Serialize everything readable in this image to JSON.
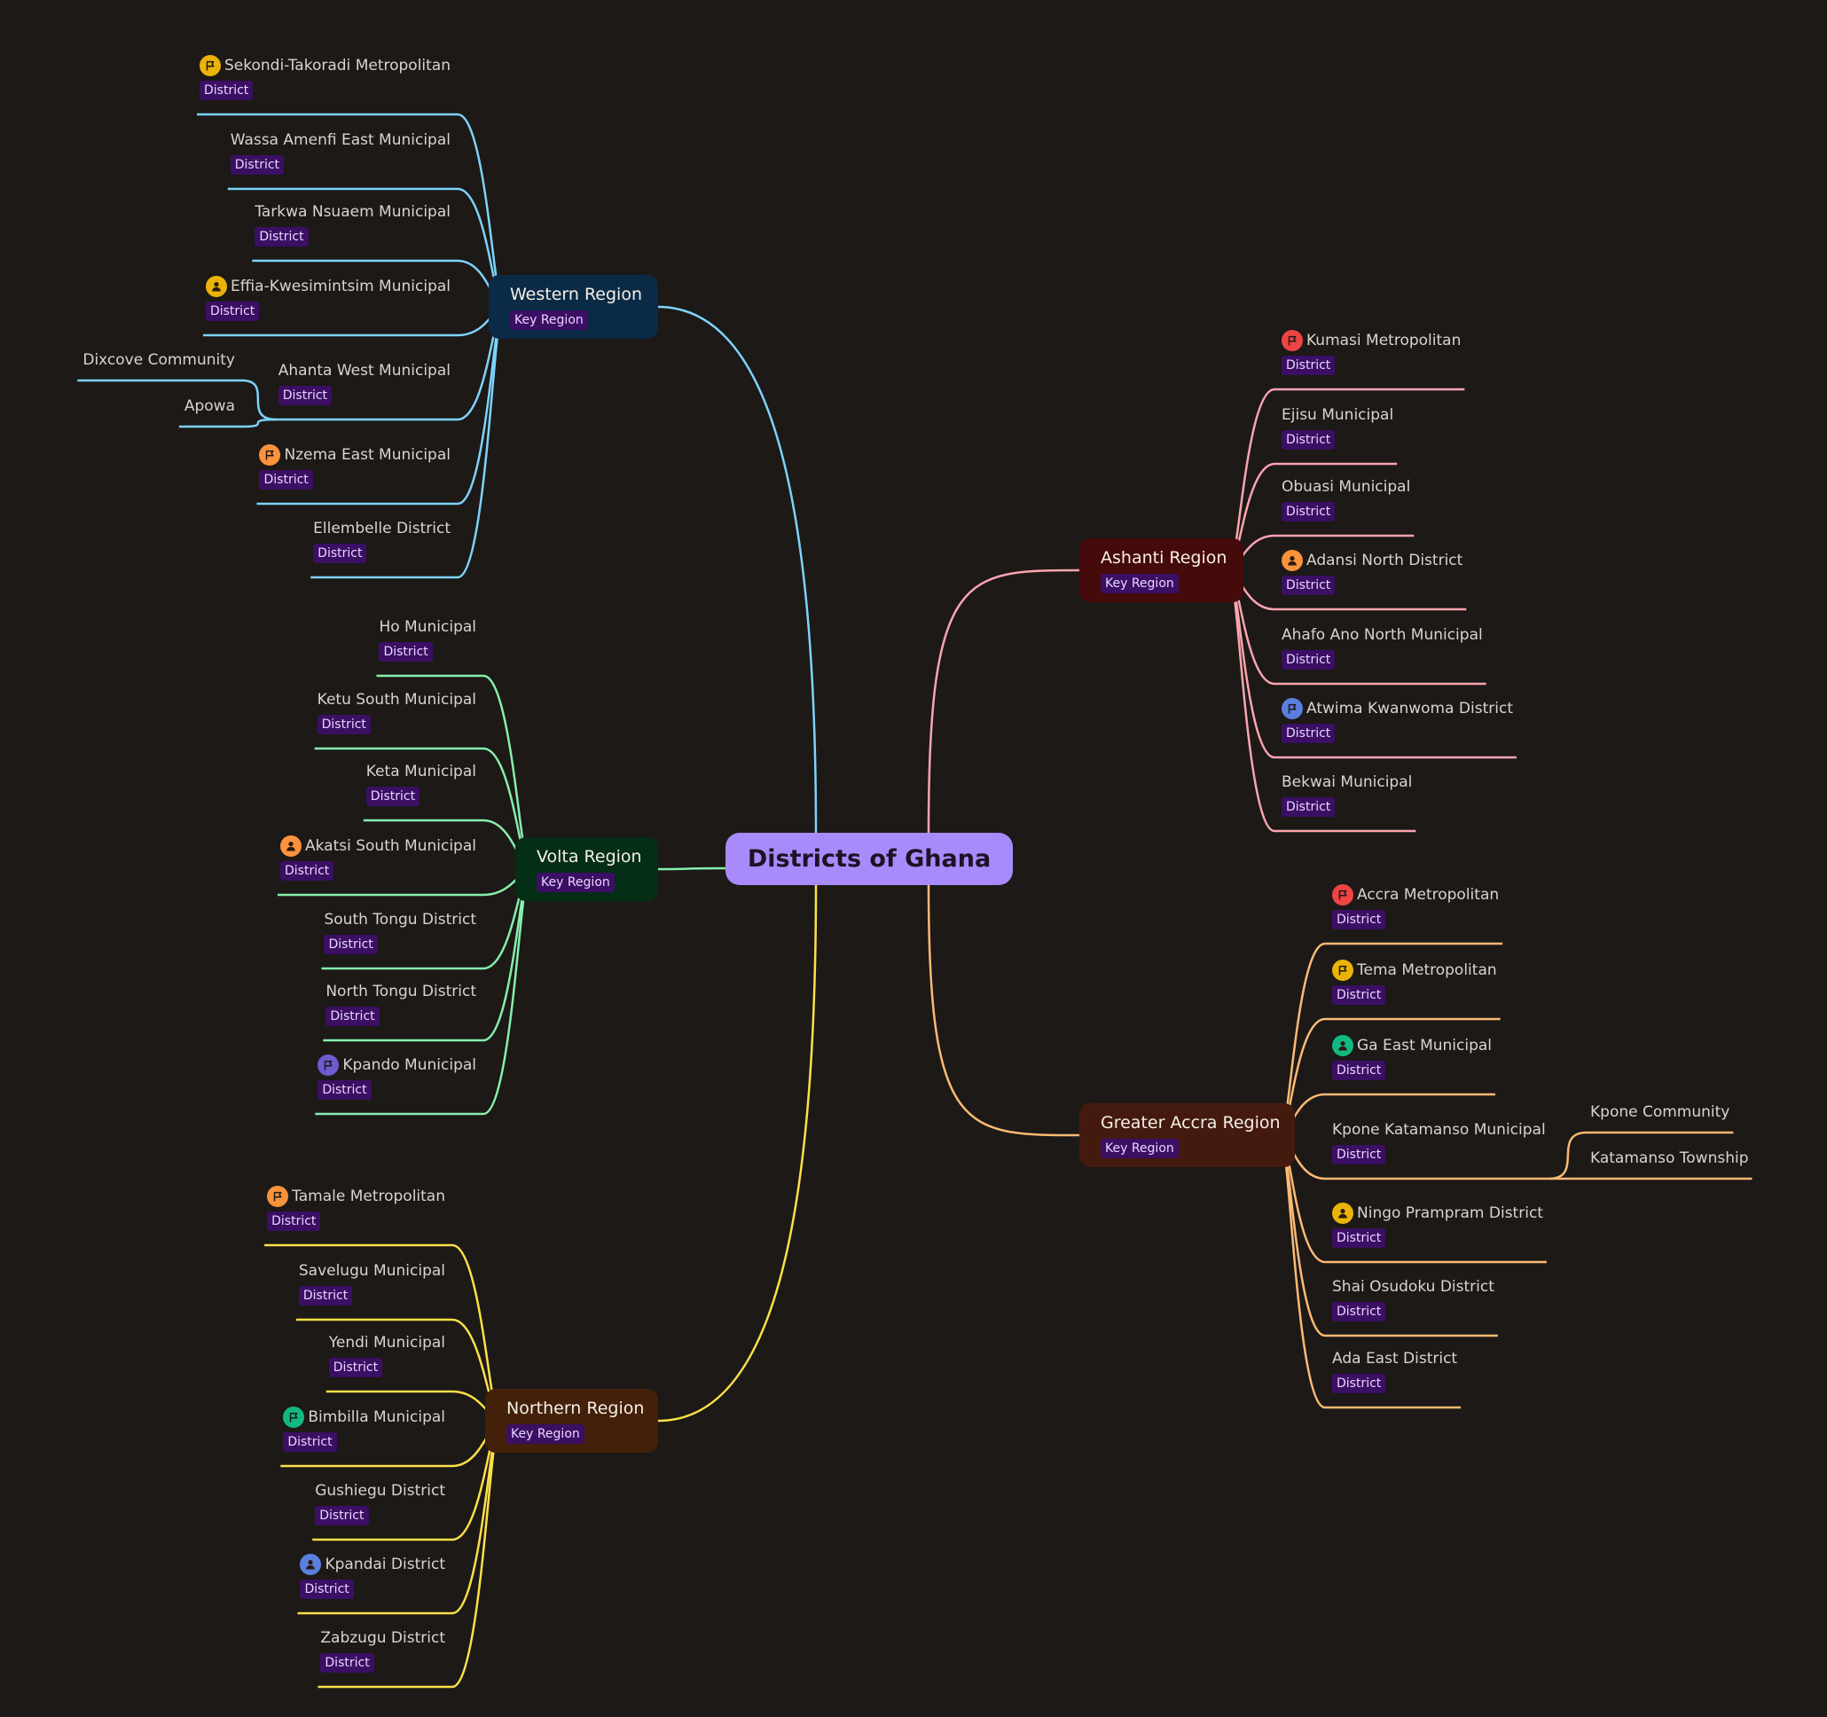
{
  "root": {
    "label": "Districts of Ghana"
  },
  "colors": {
    "background": "#1c1917",
    "root": "#a78bfa",
    "badge": "#3b0f63",
    "western": "#7dd3fc",
    "volta": "#86efac",
    "northern": "#fde047",
    "ashanti": "#fda4af",
    "greater_accra": "#fdba74"
  },
  "regions": [
    {
      "key": "western",
      "label": "Western Region",
      "badge": "Key Region",
      "color": "#7dd3fc",
      "bg": "#0b2a45",
      "districts": [
        {
          "name": "Sekondi-Takoradi Metropolitan",
          "badge": "District",
          "icon": "flag-icon",
          "icon_color": "#eab308"
        },
        {
          "name": "Wassa Amenfi East Municipal",
          "badge": "District"
        },
        {
          "name": "Tarkwa Nsuaem Municipal",
          "badge": "District"
        },
        {
          "name": "Effia-Kwesimintsim Municipal",
          "badge": "District",
          "icon": "user-icon",
          "icon_color": "#eab308"
        },
        {
          "name": "Ahanta West Municipal",
          "badge": "District",
          "children": [
            "Dixcove Community",
            "Apowa"
          ]
        },
        {
          "name": "Nzema East Municipal",
          "badge": "District",
          "icon": "flag-icon",
          "icon_color": "#fb923c"
        },
        {
          "name": "Ellembelle District",
          "badge": "District"
        }
      ]
    },
    {
      "key": "volta",
      "label": "Volta Region",
      "badge": "Key Region",
      "color": "#86efac",
      "bg": "#052e16",
      "districts": [
        {
          "name": "Ho Municipal",
          "badge": "District"
        },
        {
          "name": "Ketu South Municipal",
          "badge": "District"
        },
        {
          "name": "Keta Municipal",
          "badge": "District"
        },
        {
          "name": "Akatsi South Municipal",
          "badge": "District",
          "icon": "user-icon",
          "icon_color": "#fb923c"
        },
        {
          "name": "South Tongu District",
          "badge": "District"
        },
        {
          "name": "North Tongu District",
          "badge": "District"
        },
        {
          "name": "Kpando Municipal",
          "badge": "District",
          "icon": "flag-icon",
          "icon_color": "#6d5bd0"
        }
      ]
    },
    {
      "key": "northern",
      "label": "Northern Region",
      "badge": "Key Region",
      "color": "#fde047",
      "bg": "#42200a",
      "districts": [
        {
          "name": "Tamale Metropolitan",
          "badge": "District",
          "icon": "flag-icon",
          "icon_color": "#fb923c"
        },
        {
          "name": "Savelugu Municipal",
          "badge": "District"
        },
        {
          "name": "Yendi Municipal",
          "badge": "District"
        },
        {
          "name": "Bimbilla Municipal",
          "badge": "District",
          "icon": "flag-icon",
          "icon_color": "#10b981"
        },
        {
          "name": "Gushiegu District",
          "badge": "District"
        },
        {
          "name": "Kpandai District",
          "badge": "District",
          "icon": "user-icon",
          "icon_color": "#5b7fe0"
        },
        {
          "name": "Zabzugu District",
          "badge": "District"
        }
      ]
    },
    {
      "key": "ashanti",
      "label": "Ashanti Region",
      "badge": "Key Region",
      "color": "#fda4af",
      "bg": "#450a0a",
      "districts": [
        {
          "name": "Kumasi Metropolitan",
          "badge": "District",
          "icon": "flag-icon",
          "icon_color": "#ef4444"
        },
        {
          "name": "Ejisu Municipal",
          "badge": "District"
        },
        {
          "name": "Obuasi Municipal",
          "badge": "District"
        },
        {
          "name": "Adansi North District",
          "badge": "District",
          "icon": "user-icon",
          "icon_color": "#fb923c"
        },
        {
          "name": "Ahafo Ano North Municipal",
          "badge": "District"
        },
        {
          "name": "Atwima Kwanwoma District",
          "badge": "District",
          "icon": "flag-icon",
          "icon_color": "#5b7fe0"
        },
        {
          "name": "Bekwai Municipal",
          "badge": "District"
        }
      ]
    },
    {
      "key": "greater_accra",
      "label": "Greater Accra Region",
      "badge": "Key Region",
      "color": "#fdba74",
      "bg": "#451a0e",
      "districts": [
        {
          "name": "Accra Metropolitan",
          "badge": "District",
          "icon": "flag-icon",
          "icon_color": "#ef4444"
        },
        {
          "name": "Tema Metropolitan",
          "badge": "District",
          "icon": "flag-icon",
          "icon_color": "#eab308"
        },
        {
          "name": "Ga East Municipal",
          "badge": "District",
          "icon": "user-icon",
          "icon_color": "#10b981"
        },
        {
          "name": "Kpone Katamanso Municipal",
          "badge": "District",
          "children": [
            "Kpone Community",
            "Katamanso Township"
          ]
        },
        {
          "name": "Ningo Prampram District",
          "badge": "District",
          "icon": "user-icon",
          "icon_color": "#eab308"
        },
        {
          "name": "Shai Osudoku District",
          "badge": "District"
        },
        {
          "name": "Ada East District",
          "badge": "District"
        }
      ]
    }
  ]
}
